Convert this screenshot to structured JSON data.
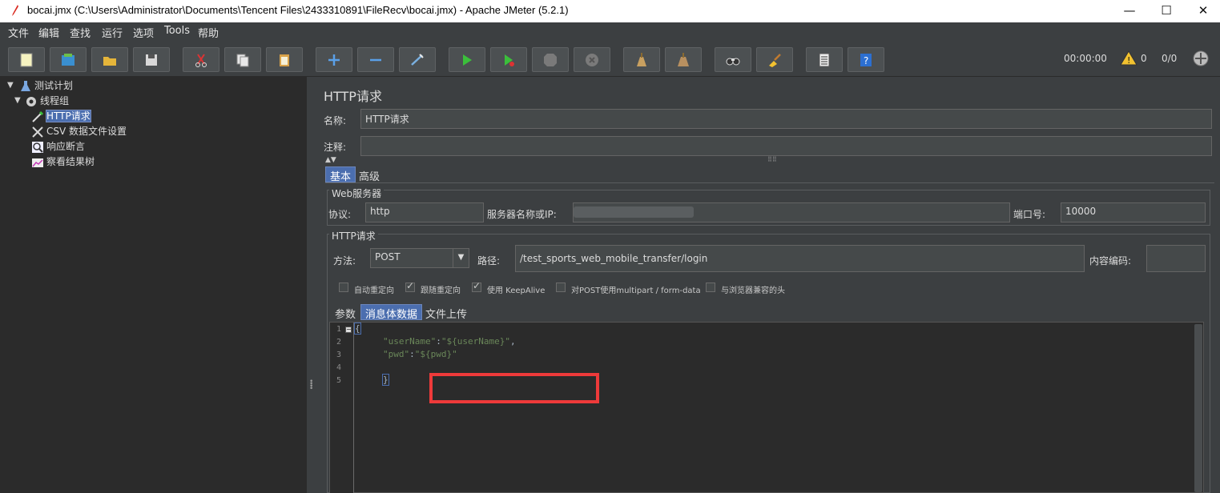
{
  "window": {
    "title": "bocai.jmx (C:\\Users\\Administrator\\Documents\\Tencent Files\\2433310891\\FileRecv\\bocai.jmx) - Apache JMeter (5.2.1)",
    "minimize": "—",
    "maximize": "☐",
    "close": "✕"
  },
  "menubar": [
    "文件",
    "编辑",
    "查找",
    "运行",
    "选项",
    "Tools",
    "帮助"
  ],
  "toolbar": {
    "timer": "00:00:00",
    "warnings": "0",
    "threads": "0/0"
  },
  "tree": {
    "nodes": [
      {
        "label": "测试计划",
        "icon": "test-plan-icon"
      },
      {
        "label": "线程组",
        "icon": "gear-icon"
      },
      {
        "label": "HTTP请求",
        "icon": "pipette-icon",
        "selected": true
      },
      {
        "label": "CSV 数据文件设置",
        "icon": "tools-icon"
      },
      {
        "label": "响应断言",
        "icon": "magnifier-icon"
      },
      {
        "label": "察看结果树",
        "icon": "chart-icon"
      }
    ]
  },
  "panel": {
    "heading": "HTTP请求",
    "name_label": "名称:",
    "name_value": "HTTP请求",
    "comment_label": "注释:",
    "comment_value": "",
    "tabs": [
      "基本",
      "高级"
    ],
    "web_server": {
      "title": "Web服务器",
      "protocol_label": "协议:",
      "protocol_value": "http",
      "server_label": "服务器名称或IP:",
      "port_label": "端口号:",
      "port_value": "10000"
    },
    "http_request": {
      "title": "HTTP请求",
      "method_label": "方法:",
      "method_value": "POST",
      "path_label": "路径:",
      "path_value": "/test_sports_web_mobile_transfer/login",
      "encoding_label": "内容编码:",
      "encoding_value": ""
    },
    "checkboxes": [
      {
        "label": "自动重定向",
        "checked": false
      },
      {
        "label": "跟随重定向",
        "checked": true
      },
      {
        "label": "使用 KeepAlive",
        "checked": true
      },
      {
        "label": "对POST使用multipart / form-data",
        "checked": false
      },
      {
        "label": "与浏览器兼容的头",
        "checked": false
      }
    ],
    "subtabs": [
      "参数",
      "消息体数据",
      "文件上传"
    ],
    "editor": {
      "line_numbers": [
        "1",
        "2",
        "3",
        "4",
        "5"
      ],
      "line1": "{",
      "line2_key": "\"userName\"",
      "line2_sep": ":",
      "line2_val": "\"${userName}\"",
      "line2_end": ",",
      "line3_key": "\"pwd\"",
      "line3_sep": ":",
      "line3_val": "\"${pwd}\"",
      "line5": "}"
    }
  }
}
